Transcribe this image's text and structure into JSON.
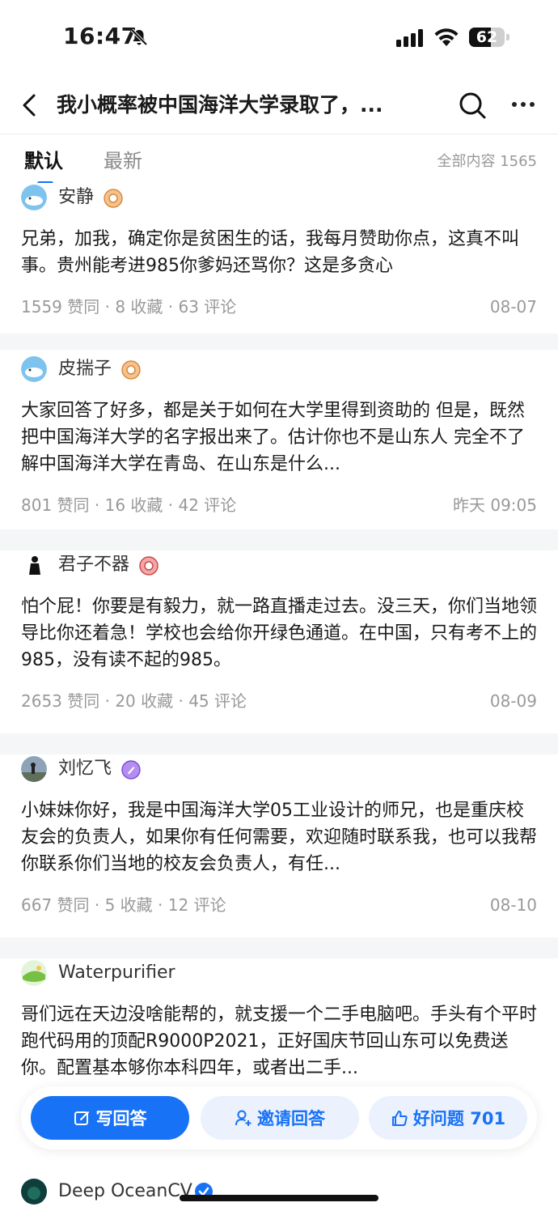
{
  "status_bar": {
    "time": "16:47",
    "battery": "62",
    "battery_level": 0.62
  },
  "nav": {
    "title": "我小概率被中国海洋大学录取了，..."
  },
  "tabs": {
    "default": "默认",
    "latest": "最新",
    "total": "全部内容 1565"
  },
  "answers": [
    {
      "author": "安静",
      "text": "兄弟，加我，确定你是贫困生的话，我每月赞助你点，这真不叫事。贵州能考进985你爹妈还骂你？这是多贪心",
      "stats": "1559 赞同 · 8 收藏 · 63 评论",
      "date": "08-07"
    },
    {
      "author": "皮揣子",
      "text": "大家回答了好多，都是关于如何在大学里得到资助的 但是，既然把中国海洋大学的名字报出来了。估计你也不是山东人 完全不了解中国海洋大学在青岛、在山东是什么...",
      "stats": "801 赞同 · 16 收藏 · 42 评论",
      "date": "昨天 09:05"
    },
    {
      "author": "君子不器",
      "text": "怕个屁！你要是有毅力，就一路直播走过去。没三天，你们当地领导比你还着急！学校也会给你开绿色通道。在中国，只有考不上的985，没有读不起的985。",
      "stats": "2653 赞同 · 20 收藏 · 45 评论",
      "date": "08-09"
    },
    {
      "author": "刘忆飞",
      "text": "小妹妹你好，我是中国海洋大学05工业设计的师兄，也是重庆校友会的负责人，如果你有任何需要，欢迎随时联系我，也可以我帮你联系你们当地的校友会负责人，有任...",
      "stats": "667 赞同 · 5 收藏 · 12 评论",
      "date": "08-10"
    },
    {
      "author": "Waterpurifier",
      "text": "哥们远在天边没啥能帮的，就支援一个二手电脑吧。手头有个平时跑代码用的顶配R9000P2021，正好国庆节回山东可以免费送你。配置基本够你本科四年，或者出二手..."
    }
  ],
  "actions": {
    "write": "写回答",
    "invite": "邀请回答",
    "good": "好问题 701"
  },
  "last_author": "Deep OceanCV",
  "colors": {
    "accent": "#1772f6",
    "accent_light": "#ebf1fd",
    "muted": "#999999"
  }
}
